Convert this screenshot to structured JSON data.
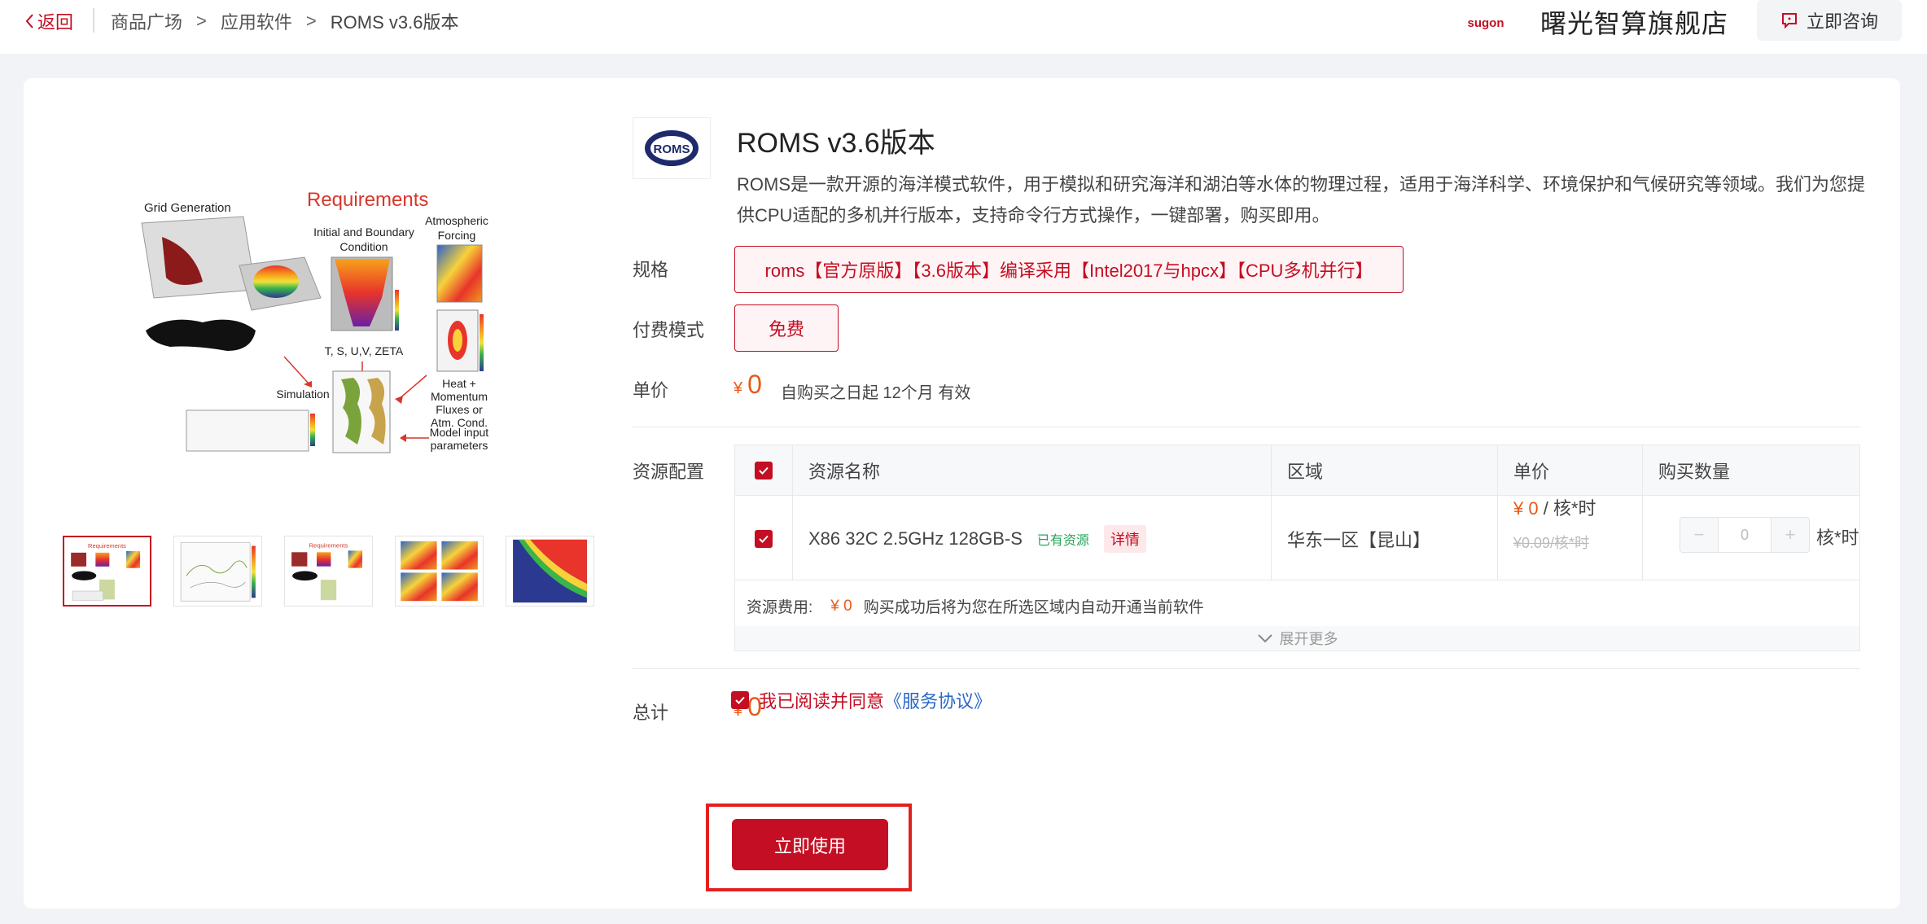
{
  "header": {
    "back_label": "返回",
    "breadcrumb": [
      "商品广场",
      "应用软件",
      "ROMS v3.6版本"
    ],
    "brand_logo_text": "sugon",
    "store_name": "曙光智算旗舰店",
    "consult_label": "立即咨询"
  },
  "gallery": {
    "main_labels": {
      "title": "Requirements",
      "grid": "Grid Generation",
      "ibc": "Initial and Boundary",
      "ibc2": "Condition",
      "atm": "Atmospheric",
      "atm2": "Forcing",
      "tsuv": "T, S, U,V, ZETA",
      "sim": "Simulation",
      "heat": "Heat +",
      "heat2": "Momentum",
      "heat3": "Fluxes or",
      "heat4": "Atm. Cond.",
      "model": "Model input",
      "model2": "parameters"
    },
    "thumbnail_count": 5,
    "selected_thumbnail": 1
  },
  "product": {
    "logo_text": "ROMS",
    "title": "ROMS v3.6版本",
    "description": "ROMS是一款开源的海洋模式软件，用于模拟和研究海洋和湖泊等水体的物理过程，适用于海洋科学、环境保护和气候研究等领域。我们为您提供CPU适配的多机并行版本，支持命令行方式操作，一键部署，购买即用。"
  },
  "labels": {
    "spec": "规格",
    "pay_mode": "付费模式",
    "unit_price": "单价",
    "resources": "资源配置",
    "total": "总计"
  },
  "spec_value": "roms【官方原版】【3.6版本】编译采用【Intel2017与hpcx】【CPU多机并行】",
  "pay_mode_value": "免费",
  "price": {
    "currency": "¥",
    "amount": "0",
    "validity": "自购买之日起 12个月 有效"
  },
  "resource_table": {
    "headers": [
      "资源名称",
      "区域",
      "单价",
      "购买数量"
    ],
    "row": {
      "name": "X86 32C 2.5GHz 128GB-S",
      "owned_tag": "已有资源",
      "detail_label": "详情",
      "region": "华东一区【昆山】",
      "price_currency": "¥",
      "price_amount": "0",
      "price_unit": "/ 核*时",
      "original_price": "¥0.09/核*时",
      "quantity": "0",
      "quantity_unit": "核*时",
      "minus": "−",
      "plus": "+"
    },
    "fee_label": "资源费用:",
    "fee_value": "¥ 0",
    "fee_note": "购买成功后将为您在所选区域内自动开通当前软件",
    "expand_label": "展开更多"
  },
  "total": {
    "currency": "¥",
    "amount": "0"
  },
  "agreement": {
    "text": "我已阅读并同意",
    "link": "《服务协议》"
  },
  "use_button": "立即使用",
  "colors": {
    "brand_red": "#c40e23",
    "price_orange": "#e85a17",
    "link_blue": "#2a67c9",
    "highlight_box": "#e32020"
  }
}
